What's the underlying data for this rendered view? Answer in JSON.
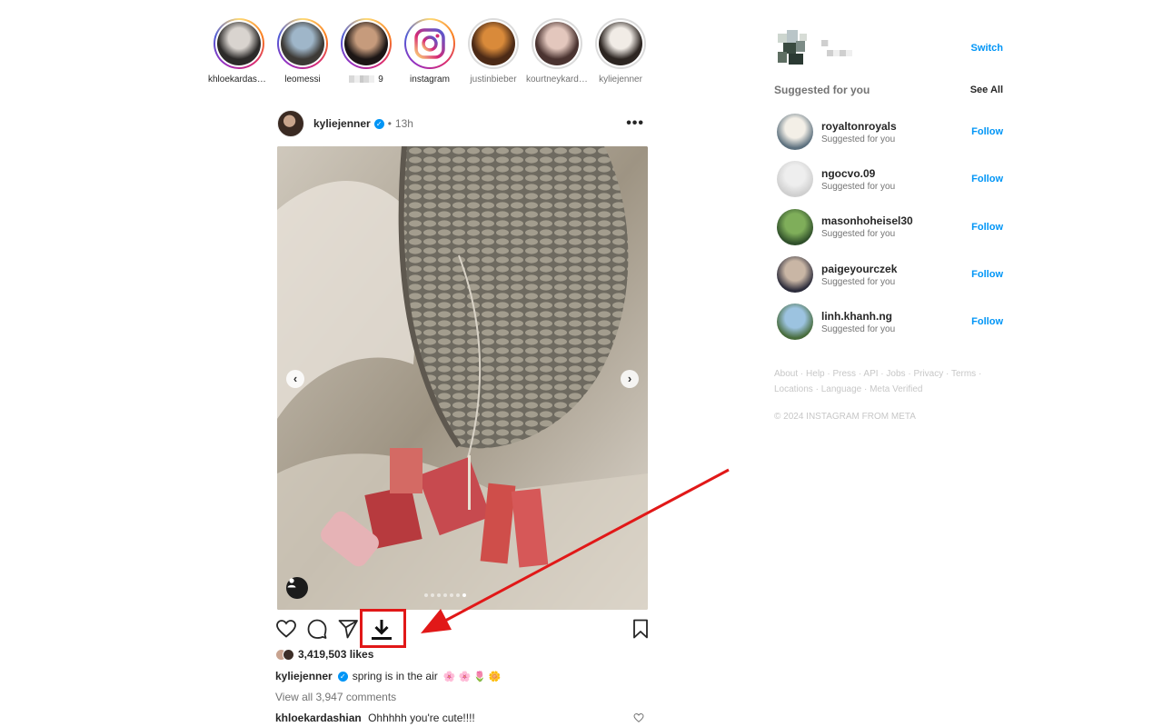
{
  "stories": [
    {
      "label": "khloekardashian",
      "ring": "gradient",
      "avatar_colors": [
        "#d9d4cf",
        "#2c2a29"
      ]
    },
    {
      "label": "leomessi",
      "ring": "gradient",
      "avatar_colors": [
        "#9fb6c9",
        "#3d3a36"
      ]
    },
    {
      "label": "9",
      "masked_prefix": true,
      "ring": "gradient",
      "avatar_colors": [
        "#c69b7c",
        "#1c1615"
      ]
    },
    {
      "label": "instagram",
      "ring": "gradient",
      "avatar_colors": [
        "#ffffff",
        "#d6249f"
      ],
      "is_logo": true
    },
    {
      "label": "justinbieber",
      "ring": "seen",
      "avatar_colors": [
        "#d98a3a",
        "#4c2a16"
      ]
    },
    {
      "label": "kourtneykardash",
      "ring": "seen",
      "avatar_colors": [
        "#e3c7bd",
        "#4a3330"
      ]
    },
    {
      "label": "kyliejenner",
      "ring": "seen",
      "avatar_colors": [
        "#f1ece6",
        "#2d2622"
      ]
    }
  ],
  "post": {
    "username": "kyliejenner",
    "time": "13h",
    "likes": "3,419,503 likes",
    "caption": "spring is in the air",
    "caption_emojis": [
      "🌸",
      "🌸",
      "🌷",
      "🌼"
    ],
    "view_comments": "View all 3,947 comments",
    "comment_user": "khloekardashian",
    "comment_text": "Ohhhhh you're cute!!!!",
    "carousel_count": 7,
    "carousel_active": 7
  },
  "sidebar": {
    "switch_label": "Switch",
    "suggested_title": "Suggested for you",
    "see_all": "See All",
    "suggestions": [
      {
        "name": "royaltonroyals",
        "sub": "Suggested for you",
        "follow": "Follow",
        "avatar_colors": [
          "#f3efe7",
          "#5b6f7d"
        ]
      },
      {
        "name": "ngocvo.09",
        "sub": "Suggested for you",
        "follow": "Follow",
        "avatar_colors": [
          "#eeeeee",
          "#cfcfcf"
        ]
      },
      {
        "name": "masonhoheisel30",
        "sub": "Suggested for you",
        "follow": "Follow",
        "avatar_colors": [
          "#7fae5a",
          "#2f4f2a"
        ]
      },
      {
        "name": "paigeyourczek",
        "sub": "Suggested for you",
        "follow": "Follow",
        "avatar_colors": [
          "#c9b6a5",
          "#2b2b3a"
        ]
      },
      {
        "name": "linh.khanh.ng",
        "sub": "Suggested for you",
        "follow": "Follow",
        "avatar_colors": [
          "#9cc3e0",
          "#476b3b"
        ]
      }
    ],
    "footer_links_line1": [
      "About",
      "Help",
      "Press",
      "API",
      "Jobs",
      "Privacy",
      "Terms"
    ],
    "footer_links_line2": [
      "Locations",
      "Language",
      "Meta Verified"
    ],
    "copyright": "© 2024 INSTAGRAM FROM META"
  },
  "colors": {
    "accent": "#0095f6",
    "annotation": "#e11818",
    "muted": "#737373"
  }
}
